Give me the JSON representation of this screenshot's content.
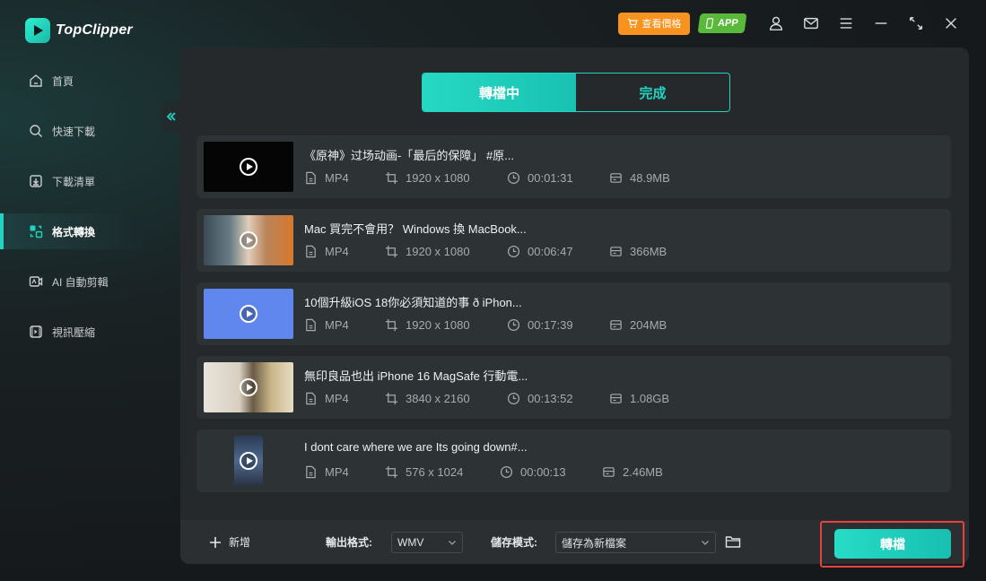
{
  "app": {
    "name": "TopClipper",
    "price_button": "查看價格",
    "app_button": "APP"
  },
  "sidebar": {
    "items": [
      {
        "label": "首頁",
        "icon": "home-icon"
      },
      {
        "label": "快速下載",
        "icon": "search-icon"
      },
      {
        "label": "下載清單",
        "icon": "download-list-icon"
      },
      {
        "label": "格式轉換",
        "icon": "convert-icon",
        "active": true
      },
      {
        "label": "AI 自動剪輯",
        "icon": "ai-edit-icon"
      },
      {
        "label": "視訊壓縮",
        "icon": "compress-icon"
      }
    ]
  },
  "tabs": {
    "converting": "轉檔中",
    "done": "完成"
  },
  "files": [
    {
      "title": "《原神》过场动画-「最后的保障」 #原...",
      "format": "MP4",
      "resolution": "1920 x 1080",
      "duration": "00:01:31",
      "size": "48.9MB"
    },
    {
      "title": "Mac 買完不會用？ Windows 換 MacBook...",
      "format": "MP4",
      "resolution": "1920 x 1080",
      "duration": "00:06:47",
      "size": "366MB"
    },
    {
      "title": "10個升級iOS 18你必須知道的事 ð iPhon...",
      "format": "MP4",
      "resolution": "1920 x 1080",
      "duration": "00:17:39",
      "size": "204MB"
    },
    {
      "title": "無印良品也出 iPhone 16 MagSafe 行動電...",
      "format": "MP4",
      "resolution": "3840 x 2160",
      "duration": "00:13:52",
      "size": "1.08GB"
    },
    {
      "title": "I dont care where we are Its going down#...",
      "format": "MP4",
      "resolution": "576 x 1024",
      "duration": "00:00:13",
      "size": "2.46MB"
    }
  ],
  "bottom": {
    "add_label": "新增",
    "output_format_label": "輸出格式:",
    "output_format_value": "WMV",
    "save_mode_label": "儲存模式:",
    "save_mode_value": "儲存為新檔案",
    "convert_label": "轉檔"
  },
  "colors": {
    "accent": "#21d3c0",
    "price": "#f7931e",
    "app_badge": "#5ab83a",
    "highlight_border": "#e8413a"
  }
}
